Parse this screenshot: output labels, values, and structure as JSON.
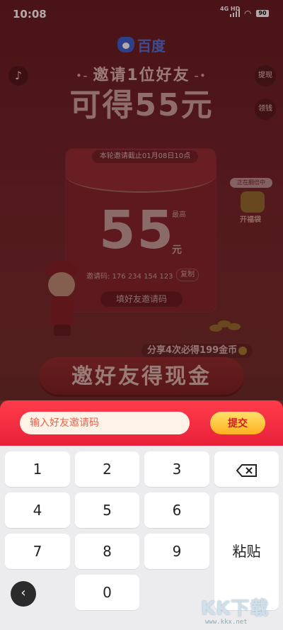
{
  "status_bar": {
    "time": "10:08",
    "network": "4G HD",
    "battery": "90"
  },
  "header": {
    "logo_text": "百度",
    "music_icon": "music-note-icon",
    "withdraw": "提现",
    "collect": "领钱"
  },
  "hero": {
    "line1": "邀请1位好友",
    "line2": "可得55元"
  },
  "envelope": {
    "deadline": "本轮邀请截止01月08日10点",
    "amount": "55",
    "max_label": "最高",
    "unit": "元",
    "invite_code": "邀请码: 176 234 154 123",
    "copy": "复制",
    "fill_code": "填好友邀请码"
  },
  "side_badge": {
    "top": "正在翻倍中",
    "label": "开福袋"
  },
  "share_note": "分享4次必得199金币",
  "main_cta": "邀好友得现金",
  "input_bar": {
    "placeholder": "输入好友邀请码",
    "value": "",
    "submit": "提交"
  },
  "keypad": {
    "keys": [
      "1",
      "2",
      "3",
      "4",
      "5",
      "6",
      "7",
      "8",
      "9",
      "0"
    ],
    "paste": "粘贴",
    "backspace_icon": "backspace-icon"
  },
  "watermark": {
    "big": "KK下载",
    "url": "www.kkx.net"
  }
}
